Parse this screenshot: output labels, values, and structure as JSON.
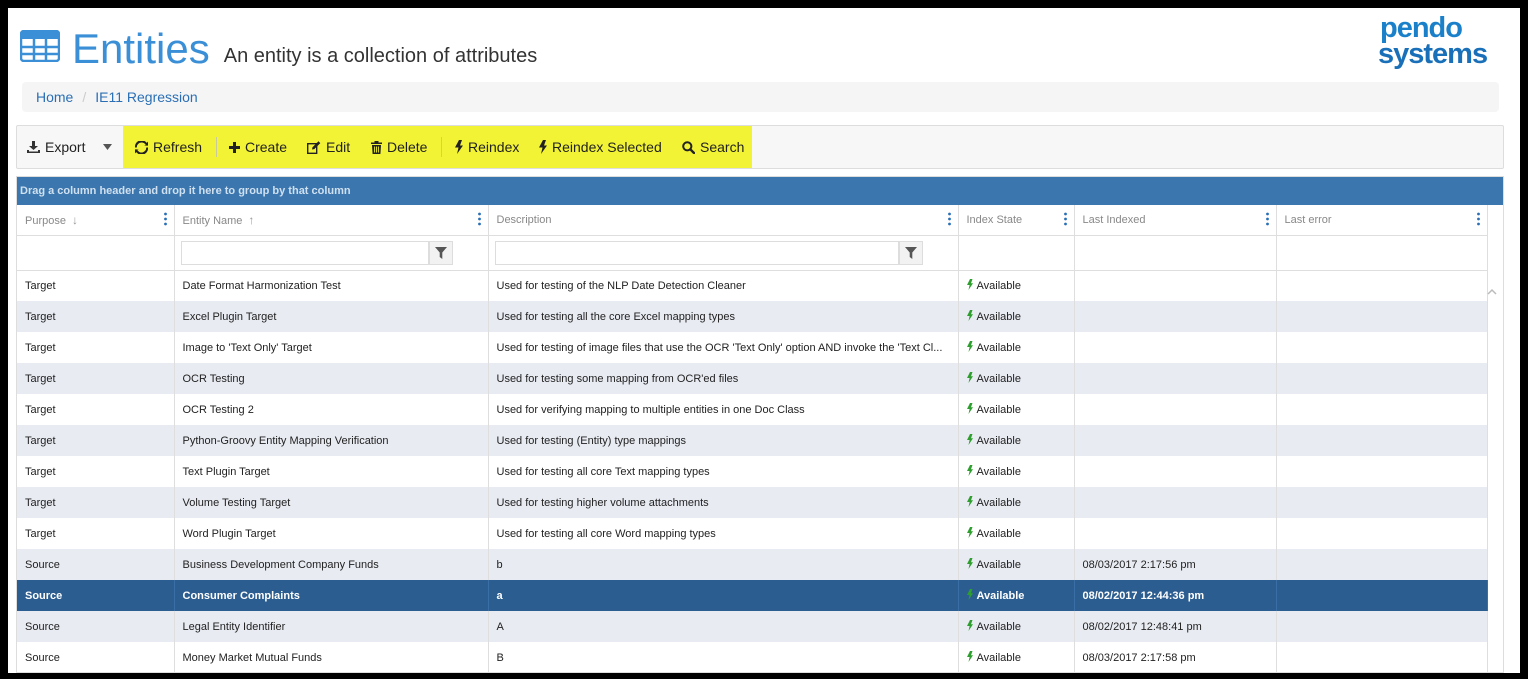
{
  "page": {
    "title": "Entities",
    "subtitle": "An entity is a collection of attributes",
    "logo_line1": "pendo",
    "logo_line2": "systems"
  },
  "breadcrumb": [
    "Home",
    "IE11 Regression"
  ],
  "toolbar": {
    "export": "Export",
    "refresh": "Refresh",
    "create": "Create",
    "edit": "Edit",
    "delete": "Delete",
    "reindex": "Reindex",
    "reindex_selected": "Reindex Selected",
    "search": "Search",
    "highlight_color": "#f3f336"
  },
  "grid": {
    "group_hint": "Drag a column header and drop it here to group by that column",
    "columns": [
      "Purpose",
      "Entity Name",
      "Description",
      "Index State",
      "Last Indexed",
      "Last error"
    ],
    "rows": [
      {
        "purpose": "Target",
        "name": "Date Format Harmonization Test",
        "description": "Used for testing of the NLP Date Detection Cleaner",
        "state": "Available",
        "indexed": "",
        "error": ""
      },
      {
        "purpose": "Target",
        "name": "Excel Plugin Target",
        "description": "Used for testing all the core Excel mapping types",
        "state": "Available",
        "indexed": "",
        "error": ""
      },
      {
        "purpose": "Target",
        "name": "Image to 'Text Only' Target",
        "description": "Used for testing of image files that use the OCR 'Text Only' option AND invoke the 'Text Cl...",
        "state": "Available",
        "indexed": "",
        "error": ""
      },
      {
        "purpose": "Target",
        "name": "OCR Testing",
        "description": "Used for testing some mapping from OCR'ed files",
        "state": "Available",
        "indexed": "",
        "error": ""
      },
      {
        "purpose": "Target",
        "name": "OCR Testing 2",
        "description": "Used for verifying mapping to multiple entities in one Doc Class",
        "state": "Available",
        "indexed": "",
        "error": ""
      },
      {
        "purpose": "Target",
        "name": "Python-Groovy Entity Mapping Verification",
        "description": "Used for testing (Entity) type mappings",
        "state": "Available",
        "indexed": "",
        "error": ""
      },
      {
        "purpose": "Target",
        "name": "Text Plugin Target",
        "description": "Used for testing all core Text mapping types",
        "state": "Available",
        "indexed": "",
        "error": ""
      },
      {
        "purpose": "Target",
        "name": "Volume Testing Target",
        "description": "Used for testing higher volume attachments",
        "state": "Available",
        "indexed": "",
        "error": ""
      },
      {
        "purpose": "Target",
        "name": "Word Plugin Target",
        "description": "Used for testing all core Word mapping types",
        "state": "Available",
        "indexed": "",
        "error": ""
      },
      {
        "purpose": "Source",
        "name": "Business Development Company Funds",
        "description": "b",
        "state": "Available",
        "indexed": "08/03/2017 2:17:56 pm",
        "error": ""
      },
      {
        "purpose": "Source",
        "name": "Consumer Complaints",
        "description": "a",
        "state": "Available",
        "indexed": "08/02/2017 12:44:36 pm",
        "error": "",
        "selected": true
      },
      {
        "purpose": "Source",
        "name": "Legal Entity Identifier",
        "description": "A",
        "state": "Available",
        "indexed": "08/02/2017 12:48:41 pm",
        "error": ""
      },
      {
        "purpose": "Source",
        "name": "Money Market Mutual Funds",
        "description": "B",
        "state": "Available",
        "indexed": "08/03/2017 2:17:58 pm",
        "error": ""
      }
    ]
  }
}
